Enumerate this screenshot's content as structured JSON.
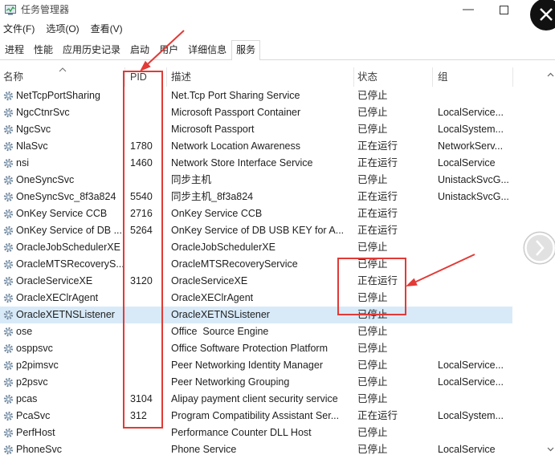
{
  "window": {
    "title": "任务管理器",
    "app_icon": "task-manager-icon",
    "minimize_icon": "minimize-icon",
    "maximize_icon": "maximize-icon"
  },
  "viewer_overlay": {
    "close_icon": "close-icon",
    "next_icon": "chevron-right-icon"
  },
  "menu": {
    "items": [
      "文件(F)",
      "选项(O)",
      "查看(V)"
    ]
  },
  "tabs": {
    "items": [
      "进程",
      "性能",
      "应用历史记录",
      "启动",
      "用户",
      "详细信息",
      "服务"
    ],
    "active_index": 6
  },
  "columns": {
    "name": "名称",
    "pid": "PID",
    "description": "描述",
    "status": "状态",
    "group": "组"
  },
  "sort": {
    "column_index": 0,
    "icon": "sort-ascending-icon"
  },
  "row_icon": "service-icon",
  "selected_index": 13,
  "services": [
    {
      "name": "NetTcpPortSharing",
      "pid": "",
      "description": "Net.Tcp Port Sharing Service",
      "status": "已停止",
      "group": ""
    },
    {
      "name": "NgcCtnrSvc",
      "pid": "",
      "description": "Microsoft Passport Container",
      "status": "已停止",
      "group": "LocalService..."
    },
    {
      "name": "NgcSvc",
      "pid": "",
      "description": "Microsoft Passport",
      "status": "已停止",
      "group": "LocalSystem..."
    },
    {
      "name": "NlaSvc",
      "pid": "1780",
      "description": "Network Location Awareness",
      "status": "正在运行",
      "group": "NetworkServ..."
    },
    {
      "name": "nsi",
      "pid": "1460",
      "description": "Network Store Interface Service",
      "status": "正在运行",
      "group": "LocalService"
    },
    {
      "name": "OneSyncSvc",
      "pid": "",
      "description": "同步主机",
      "status": "已停止",
      "group": "UnistackSvcG..."
    },
    {
      "name": "OneSyncSvc_8f3a824",
      "pid": "5540",
      "description": "同步主机_8f3a824",
      "status": "正在运行",
      "group": "UnistackSvcG..."
    },
    {
      "name": "OnKey Service CCB",
      "pid": "2716",
      "description": "OnKey Service CCB",
      "status": "正在运行",
      "group": ""
    },
    {
      "name": "OnKey Service of DB ...",
      "pid": "5264",
      "description": "OnKey Service of DB USB KEY for A...",
      "status": "正在运行",
      "group": ""
    },
    {
      "name": "OracleJobSchedulerXE",
      "pid": "",
      "description": "OracleJobSchedulerXE",
      "status": "已停止",
      "group": ""
    },
    {
      "name": "OracleMTSRecoveryS...",
      "pid": "",
      "description": "OracleMTSRecoveryService",
      "status": "已停止",
      "group": ""
    },
    {
      "name": "OracleServiceXE",
      "pid": "3120",
      "description": "OracleServiceXE",
      "status": "正在运行",
      "group": ""
    },
    {
      "name": "OracleXEClrAgent",
      "pid": "",
      "description": "OracleXEClrAgent",
      "status": "已停止",
      "group": ""
    },
    {
      "name": "OracleXETNSListener",
      "pid": "",
      "description": "OracleXETNSListener",
      "status": "已停止",
      "group": ""
    },
    {
      "name": "ose",
      "pid": "",
      "description": "Office  Source Engine",
      "status": "已停止",
      "group": ""
    },
    {
      "name": "osppsvc",
      "pid": "",
      "description": "Office Software Protection Platform",
      "status": "已停止",
      "group": ""
    },
    {
      "name": "p2pimsvc",
      "pid": "",
      "description": "Peer Networking Identity Manager",
      "status": "已停止",
      "group": "LocalService..."
    },
    {
      "name": "p2psvc",
      "pid": "",
      "description": "Peer Networking Grouping",
      "status": "已停止",
      "group": "LocalService..."
    },
    {
      "name": "pcas",
      "pid": "3104",
      "description": "Alipay payment client security service",
      "status": "已停止",
      "group": ""
    },
    {
      "name": "PcaSvc",
      "pid": "312",
      "description": "Program Compatibility Assistant Ser...",
      "status": "正在运行",
      "group": "LocalSystem..."
    },
    {
      "name": "PerfHost",
      "pid": "",
      "description": "Performance Counter DLL Host",
      "status": "已停止",
      "group": ""
    },
    {
      "name": "PhoneSvc",
      "pid": "",
      "description": "Phone Service",
      "status": "已停止",
      "group": "LocalService"
    }
  ],
  "scrollbar": {
    "up_icon": "scroll-up-icon",
    "down_icon": "scroll-down-icon"
  },
  "colors": {
    "selected_row": "#d8eaf8",
    "annotation": "#e23a36",
    "tab_border": "#d9d9d9"
  }
}
